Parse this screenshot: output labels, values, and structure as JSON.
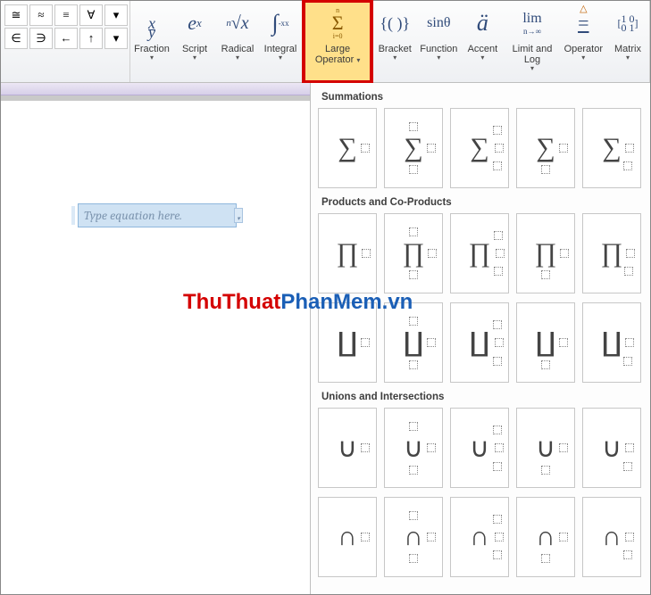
{
  "ribbon": {
    "symbols_row1": [
      "≅",
      "≈",
      "≡",
      "∀",
      "▾"
    ],
    "symbols_row2": [
      "∈",
      "∋",
      "←",
      "↑",
      "▾"
    ],
    "groups": {
      "fraction": {
        "icon": "x⁄y",
        "label": "Fraction"
      },
      "script": {
        "icon": "eˣ",
        "label": "Script"
      },
      "radical": {
        "icon": "ⁿ√x",
        "label": "Radical"
      },
      "integral": {
        "icon": "∫₋ₓˣ",
        "label": "Integral"
      },
      "large_op": {
        "icon": "Σ",
        "label": "Large Operator",
        "sub": "i=0",
        "sup": "n"
      },
      "bracket": {
        "icon": "{()}",
        "label": "Bracket"
      },
      "function": {
        "icon": "sinθ",
        "label": "Function"
      },
      "accent": {
        "icon": "ä",
        "label": "Accent"
      },
      "limit": {
        "icon": "lim",
        "label": "Limit and Log",
        "sub": "n→∞"
      },
      "operator": {
        "icon": "≜",
        "label": "Operator"
      },
      "matrix": {
        "icon": "[10;01]",
        "label": "Matrix"
      }
    }
  },
  "equation_placeholder": "Type equation here.",
  "panel": {
    "sections": [
      {
        "title": "Summations",
        "glyph": "∑",
        "rows": 1
      },
      {
        "title": "Products and Co-Products",
        "glyph": "∏",
        "rows": 2,
        "glyph2": "∐"
      },
      {
        "title": "Unions and Intersections",
        "glyph": "∪",
        "rows": 2,
        "glyph2": "∩"
      }
    ],
    "variants": [
      "v1",
      "v2",
      "v3",
      "v4",
      "v5"
    ]
  },
  "watermark": {
    "part1": "ThuThuat",
    "part2": "PhanMem.vn"
  }
}
